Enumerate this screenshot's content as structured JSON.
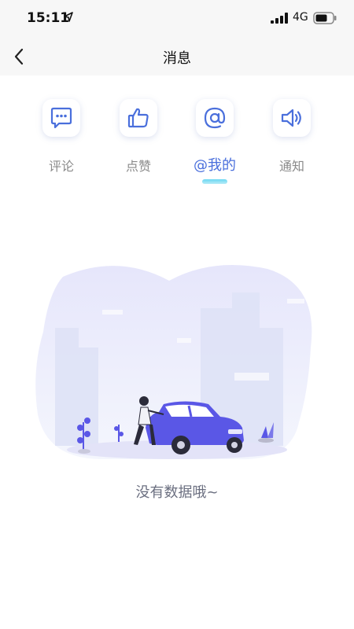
{
  "status_bar": {
    "time": "15:11",
    "network": "4G",
    "icons": [
      "location-arrow-icon",
      "signal-icon",
      "battery-icon"
    ]
  },
  "nav": {
    "title": "消息",
    "back_icon": "chevron-left-icon"
  },
  "tabs": [
    {
      "label": "评论",
      "icon": "comment-icon",
      "active": false
    },
    {
      "label": "点赞",
      "icon": "thumbs-up-icon",
      "active": false
    },
    {
      "label": "@我的",
      "icon": "at-icon",
      "active": true
    },
    {
      "label": "通知",
      "icon": "speaker-icon",
      "active": false
    }
  ],
  "empty_state": {
    "message": "没有数据哦~",
    "illustration": "person-with-car-city-illustration"
  },
  "colors": {
    "accent": "#4a6fdc",
    "indicator": "#6ad7f2",
    "car": "#5a57e6",
    "inactive_text": "#8a8a8a"
  }
}
